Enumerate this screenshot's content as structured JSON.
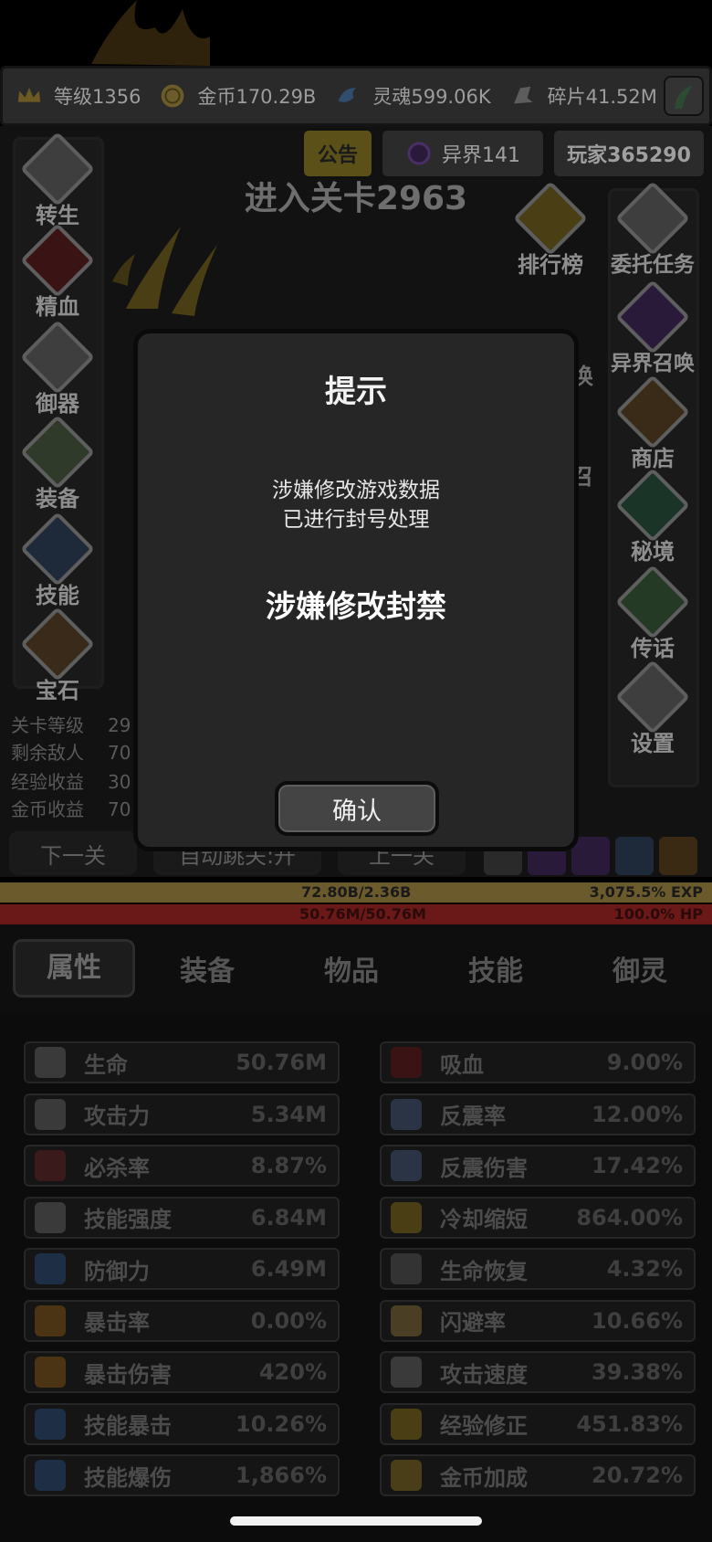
{
  "resources": [
    {
      "label": "等级1356",
      "icon": "crown-icon",
      "color": "#b8962d"
    },
    {
      "label": "金币170.29B",
      "icon": "coin-icon",
      "color": "#a28a3a"
    },
    {
      "label": "灵魂599.06K",
      "icon": "soul-icon",
      "color": "#4f7aa8"
    },
    {
      "label": "碎片41.52M",
      "icon": "shard-icon",
      "color": "#9a9a9a"
    }
  ],
  "top_buttons": {
    "notice": "公告",
    "otherworld": "异界141",
    "player": "玩家365290"
  },
  "stage_title": "进入关卡2963",
  "left_menu": [
    "转生",
    "精血",
    "御器",
    "装备",
    "技能",
    "宝石"
  ],
  "right_menu": [
    "排行榜",
    "委托任务",
    "异界召唤",
    "商店",
    "秘境",
    "传话",
    "设置"
  ],
  "right_menu_partial": [
    "唤",
    "召"
  ],
  "stage_stats": [
    {
      "label": "关卡等级",
      "value": "29"
    },
    {
      "label": "剩余敌人",
      "value": "70"
    },
    {
      "label": "经验收益",
      "value": "30"
    },
    {
      "label": "金币收益",
      "value": "70"
    }
  ],
  "nav": {
    "next": "下一关",
    "auto": "自动跳关:开",
    "prev": "上一关"
  },
  "exp_bar": {
    "text": "72.80B/2.36B",
    "percent_text": "3,075.5% EXP",
    "fill": 1.0
  },
  "hp_bar": {
    "text": "50.76M/50.76M",
    "percent_text": "100.0%  HP",
    "fill": 1.0
  },
  "tabs": [
    "属性",
    "装备",
    "物品",
    "技能",
    "御灵"
  ],
  "active_tab": 0,
  "attributes_left": [
    {
      "name": "生命",
      "value": "50.76M",
      "icon": "life-icon"
    },
    {
      "name": "攻击力",
      "value": "5.34M",
      "icon": "sword-icon"
    },
    {
      "name": "必杀率",
      "value": "8.87%",
      "icon": "crit-kill-icon"
    },
    {
      "name": "技能强度",
      "value": "6.84M",
      "icon": "lightning-icon"
    },
    {
      "name": "防御力",
      "value": "6.49M",
      "icon": "shield-icon"
    },
    {
      "name": "暴击率",
      "value": "0.00%",
      "icon": "flame-icon"
    },
    {
      "name": "暴击伤害",
      "value": "420%",
      "icon": "flame-icon"
    },
    {
      "name": "技能暴击",
      "value": "10.26%",
      "icon": "blue-flame-icon"
    },
    {
      "name": "技能爆伤",
      "value": "1,866%",
      "icon": "blue-flame-icon"
    }
  ],
  "attributes_right": [
    {
      "name": "吸血",
      "value": "9.00%",
      "icon": "bat-icon"
    },
    {
      "name": "反震率",
      "value": "12.00%",
      "icon": "burst-icon"
    },
    {
      "name": "反震伤害",
      "value": "17.42%",
      "icon": "burst-icon"
    },
    {
      "name": "冷却缩短",
      "value": "864.00%",
      "icon": "cooldown-icon"
    },
    {
      "name": "生命恢复",
      "value": "4.32%",
      "icon": "regen-icon"
    },
    {
      "name": "闪避率",
      "value": "10.66%",
      "icon": "boot-icon"
    },
    {
      "name": "攻击速度",
      "value": "39.38%",
      "icon": "speed-icon"
    },
    {
      "name": "经验修正",
      "value": "451.83%",
      "icon": "crown-icon"
    },
    {
      "name": "金币加成",
      "value": "20.72%",
      "icon": "coin-icon"
    }
  ],
  "modal": {
    "title": "提示",
    "line1": "涉嫌修改游戏数据",
    "line2": "已进行封号处理",
    "ban_text": "涉嫌修改封禁",
    "confirm": "确认"
  }
}
